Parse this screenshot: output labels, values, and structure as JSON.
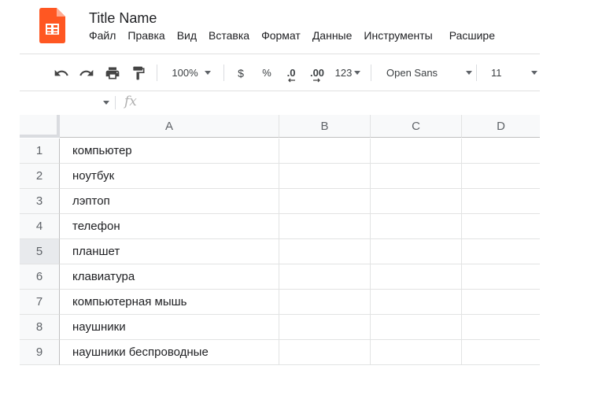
{
  "app": {
    "title": "Title Name",
    "brand_color": "#0f9d58",
    "logo_icon": "sheets-logo-icon"
  },
  "menu": [
    "Файл",
    "Правка",
    "Вид",
    "Вставка",
    "Формат",
    "Данные",
    "Инструменты",
    "Расшире"
  ],
  "toolbar": {
    "undo_icon": "undo-icon",
    "redo_icon": "redo-icon",
    "print_icon": "print-icon",
    "paint_format_icon": "paint-format-icon",
    "zoom": "100%",
    "currency": "$",
    "percent": "%",
    "decrease_decimal": ".0",
    "increase_decimal": ".00",
    "more_formats": "123",
    "font": "Open Sans",
    "font_size": "11"
  },
  "formula_bar": {
    "fx_label": "fx",
    "value": ""
  },
  "sheet": {
    "columns": [
      "A",
      "B",
      "C",
      "D"
    ],
    "rows": [
      {
        "num": "1",
        "a": "компьютер"
      },
      {
        "num": "2",
        "a": "ноутбук"
      },
      {
        "num": "3",
        "a": "лэптоп"
      },
      {
        "num": "4",
        "a": "телефон"
      },
      {
        "num": "5",
        "a": "планшет"
      },
      {
        "num": "6",
        "a": "клавиатура"
      },
      {
        "num": "7",
        "a": "компьютерная мышь"
      },
      {
        "num": "8",
        "a": "наушники"
      },
      {
        "num": "9",
        "a": "наушники беспроводные"
      }
    ],
    "selected_row": "5"
  }
}
